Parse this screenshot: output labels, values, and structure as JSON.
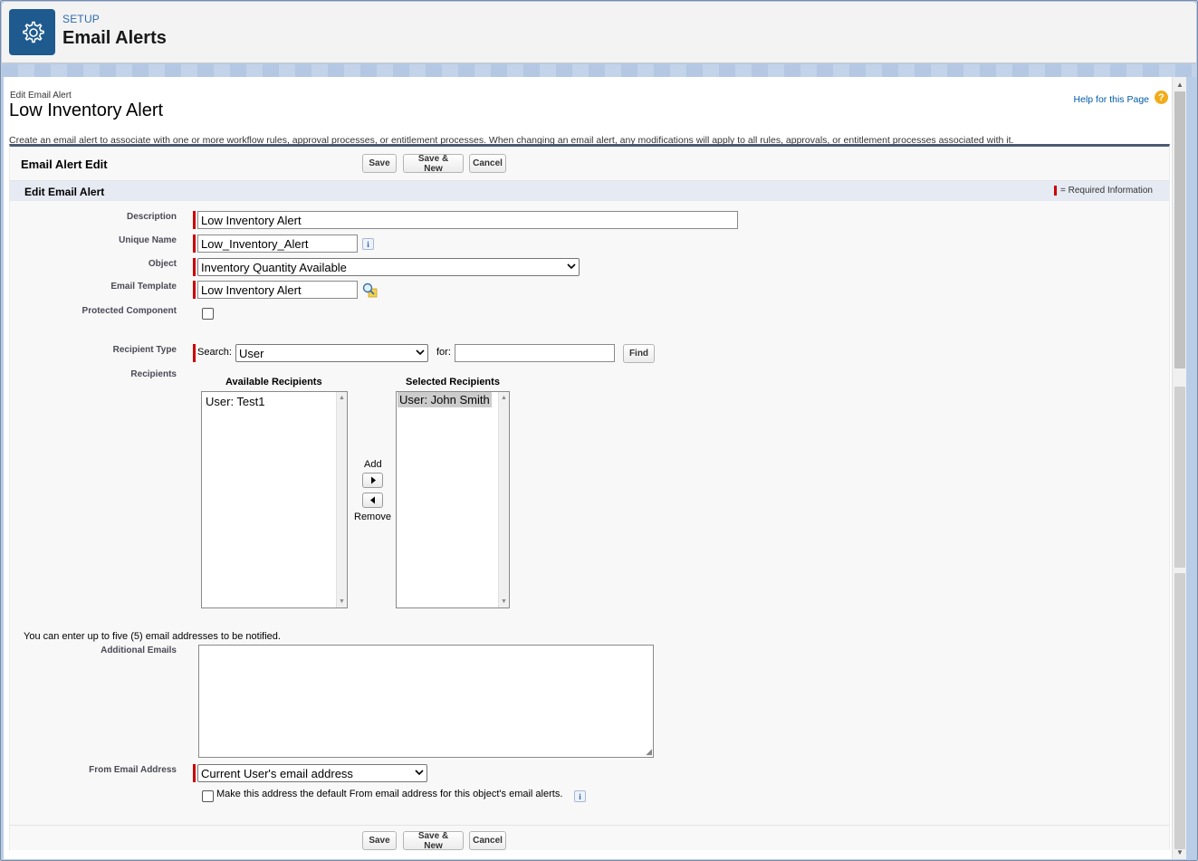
{
  "header": {
    "setup_label": "SETUP",
    "title": "Email Alerts",
    "icon": "gear-icon"
  },
  "page": {
    "edit_label": "Edit Email Alert",
    "record_title": "Low Inventory Alert",
    "help_link": "Help for this Page",
    "help_icon": "?",
    "intro": "Create an email alert to associate with one or more workflow rules, approval processes, or entitlement processes. When changing an email alert, any modifications will apply to all rules, approvals, or entitlement processes associated with it."
  },
  "form": {
    "block_title": "Email Alert Edit",
    "buttons": {
      "save": "Save",
      "save_new": "Save & New",
      "cancel": "Cancel"
    },
    "section_title": "Edit Email Alert",
    "required_legend": "= Required Information",
    "description": {
      "label": "Description",
      "value": "Low Inventory Alert"
    },
    "unique_name": {
      "label": "Unique Name",
      "value": "Low_Inventory_Alert",
      "info": "i"
    },
    "object": {
      "label": "Object",
      "value": "Inventory Quantity Available"
    },
    "email_template": {
      "label": "Email Template",
      "value": "Low Inventory Alert"
    },
    "protected_component": {
      "label": "Protected Component",
      "checked": false
    },
    "recipient_type": {
      "label": "Recipient Type",
      "search_label": "Search:",
      "search_value": "User",
      "for_label": "for:",
      "for_value": "",
      "find_button": "Find"
    },
    "recipients": {
      "label": "Recipients",
      "available_header": "Available Recipients",
      "available": [
        "User: Test1"
      ],
      "selected_header": "Selected Recipients",
      "selected": [
        "User: John Smith"
      ],
      "add_label": "Add",
      "remove_label": "Remove"
    },
    "additional_emails": {
      "note": "You can enter up to five (5) email addresses to be notified.",
      "label": "Additional Emails",
      "value": ""
    },
    "from_email": {
      "label": "From Email Address",
      "value": "Current User's email address",
      "default_checkbox_label": "Make this address the default From email address for this object's email alerts.",
      "default_checked": false,
      "info": "i"
    }
  },
  "colors": {
    "header_tile": "#1f5a8e",
    "required": "#cc0000",
    "link": "#015ba7",
    "help_icon": "#f0ad1a"
  }
}
